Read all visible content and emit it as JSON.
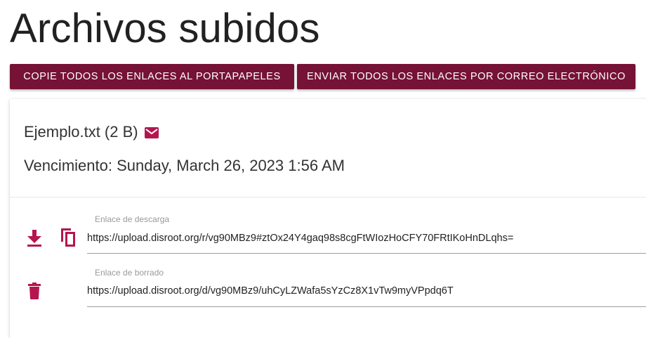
{
  "page": {
    "title": "Archivos subidos"
  },
  "toolbar": {
    "copy_all_label": "COPIE TODOS LOS ENLACES AL PORTAPAPELES",
    "email_all_label": "ENVIAR TODOS LOS ENLACES POR CORREO ELECTRÓNICO"
  },
  "file": {
    "name_and_size": "Ejemplo.txt (2 B)",
    "expiry": "Vencimiento: Sunday, March 26, 2023 1:56 AM",
    "download": {
      "label": "Enlace de descarga",
      "url": "https://upload.disroot.org/r/vg90MBz9#ztOx24Y4gaq98s8cgFtWIozHoCFY70FRtIKoHnDLqhs="
    },
    "delete": {
      "label": "Enlace de borrado",
      "url": "https://upload.disroot.org/d/vg90MBz9/uhCyLZWafa5sYzCz8X1vTw9myVPpdq6T"
    }
  },
  "colors": {
    "brand": "#751235",
    "icon_accent": "#b5154f"
  },
  "icons": [
    "mail-icon",
    "download-icon",
    "copy-icon",
    "delete-icon"
  ]
}
